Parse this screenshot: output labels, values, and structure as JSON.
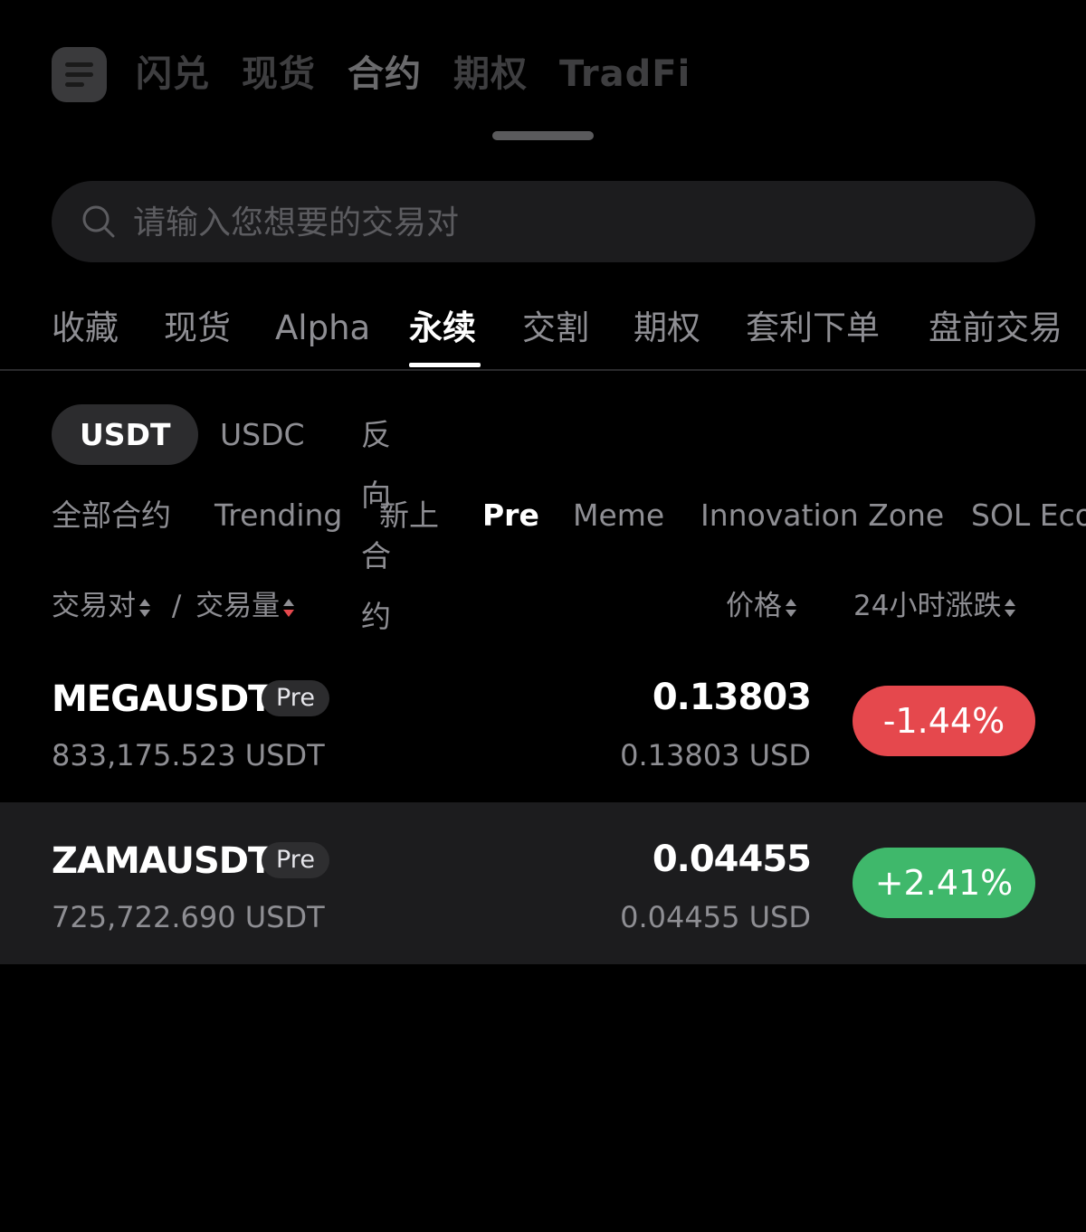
{
  "top_nav": {
    "tabs": [
      "闪兑",
      "现货",
      "合约",
      "期权",
      "TradFi"
    ],
    "active_tab": "合约"
  },
  "search": {
    "placeholder": "请输入您想要的交易对"
  },
  "categories": {
    "items": [
      "收藏",
      "现货",
      "Alpha",
      "永续",
      "交割",
      "期权",
      "套利下单",
      "盘前交易"
    ],
    "active": "永续"
  },
  "currency_segment": {
    "items": [
      "USDT",
      "USDC",
      "反向合约"
    ],
    "active": "USDT"
  },
  "sub_filters": {
    "items": [
      "全部合约",
      "Trending",
      "新上",
      "Pre",
      "Meme",
      "Innovation Zone",
      "SOL Eco"
    ],
    "active": "Pre"
  },
  "table_header": {
    "pair": "交易对",
    "separator": "/",
    "volume": "交易量",
    "price": "价格",
    "change": "24小时涨跌"
  },
  "rows": [
    {
      "symbol": "MEGAUSDT",
      "badge": "Pre",
      "volume": "833,175.523 USDT",
      "price": "0.13803",
      "price_usd": "0.13803 USD",
      "change": "-1.44%",
      "direction": "down"
    },
    {
      "symbol": "ZAMAUSDT",
      "badge": "Pre",
      "volume": "725,722.690 USDT",
      "price": "0.04455",
      "price_usd": "0.04455 USD",
      "change": "+2.41%",
      "direction": "up"
    }
  ],
  "colors": {
    "background": "#000000",
    "down": "#e5484d",
    "up": "#3fb86b",
    "muted_text": "#8e8e93"
  }
}
